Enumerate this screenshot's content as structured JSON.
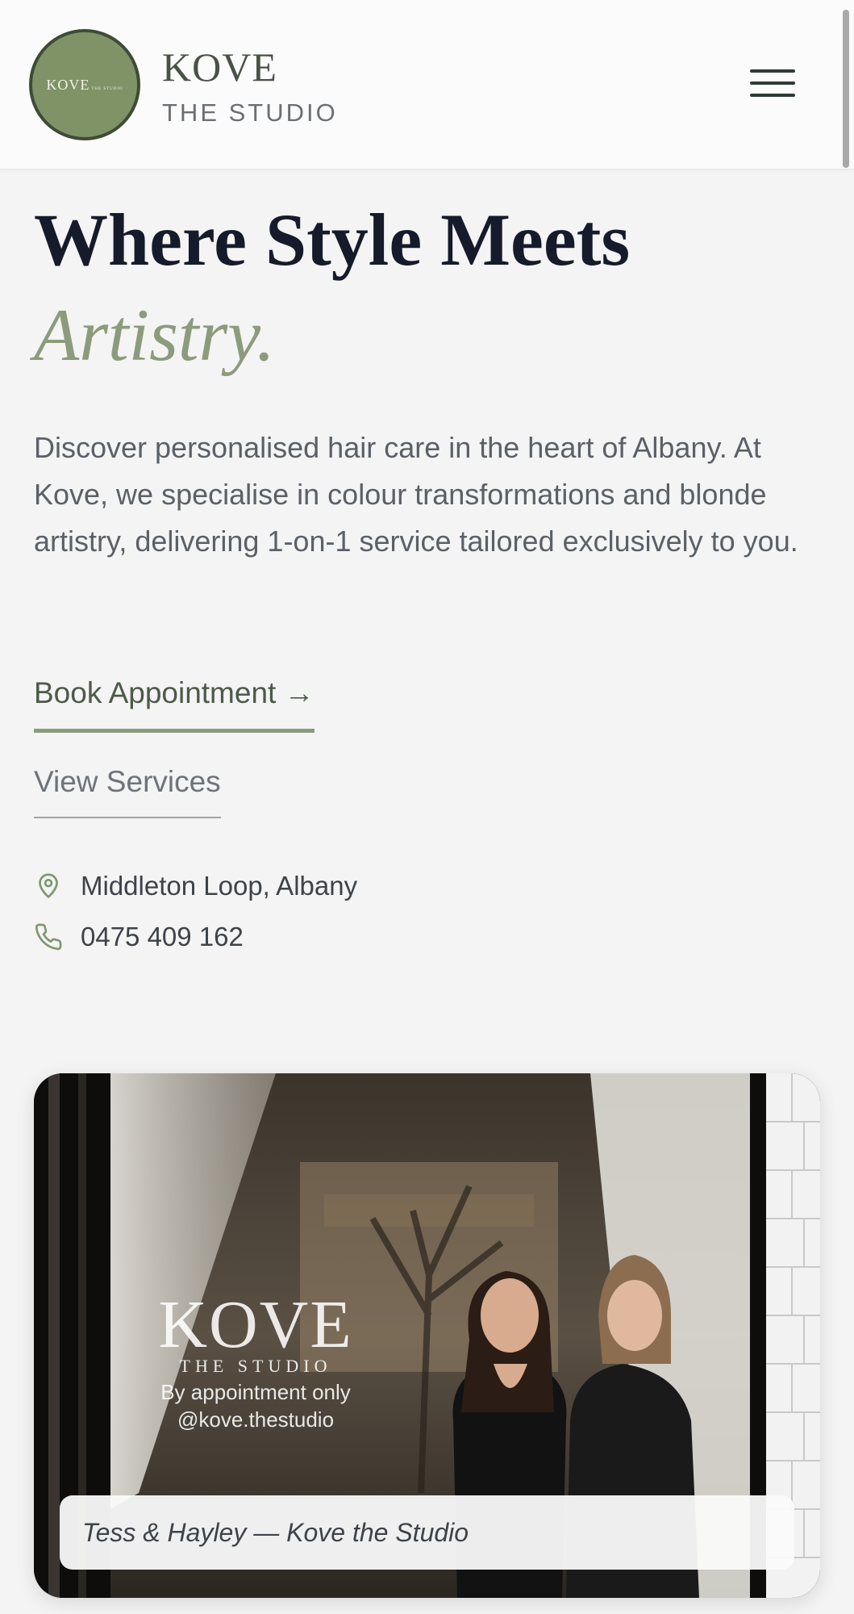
{
  "header": {
    "logo_badge_text": "KOVE",
    "logo_badge_subtext": "THE STUDIO",
    "brand_name": "KOVE",
    "brand_subtitle": "THE STUDIO",
    "menu_icon": "hamburger-menu-icon"
  },
  "hero": {
    "heading_line1": "Where Style Meets",
    "heading_line2": "Artistry.",
    "intro": "Discover personalised hair care in the heart of Albany. At Kove, we specialise in colour transformations and blonde artistry, delivering 1-on-1 service tailored exclusively to you.",
    "book_label": "Book Appointment →",
    "services_label": "View Services"
  },
  "contact": {
    "address": "Middleton Loop, Albany",
    "address_icon": "map-pin-icon",
    "phone": "0475 409 162",
    "phone_icon": "phone-icon"
  },
  "photo": {
    "window_brand": "KOVE",
    "window_brand_sub": "THE STUDIO",
    "window_line1": "By appointment only",
    "window_line2": "@kove.thestudio",
    "caption": "Tess & Hayley — Kove the Studio"
  },
  "colors": {
    "accent_green": "#8a9c7f",
    "logo_green": "#7f9366",
    "heading_dark": "#161b2b",
    "background": "#f4f4f4"
  }
}
